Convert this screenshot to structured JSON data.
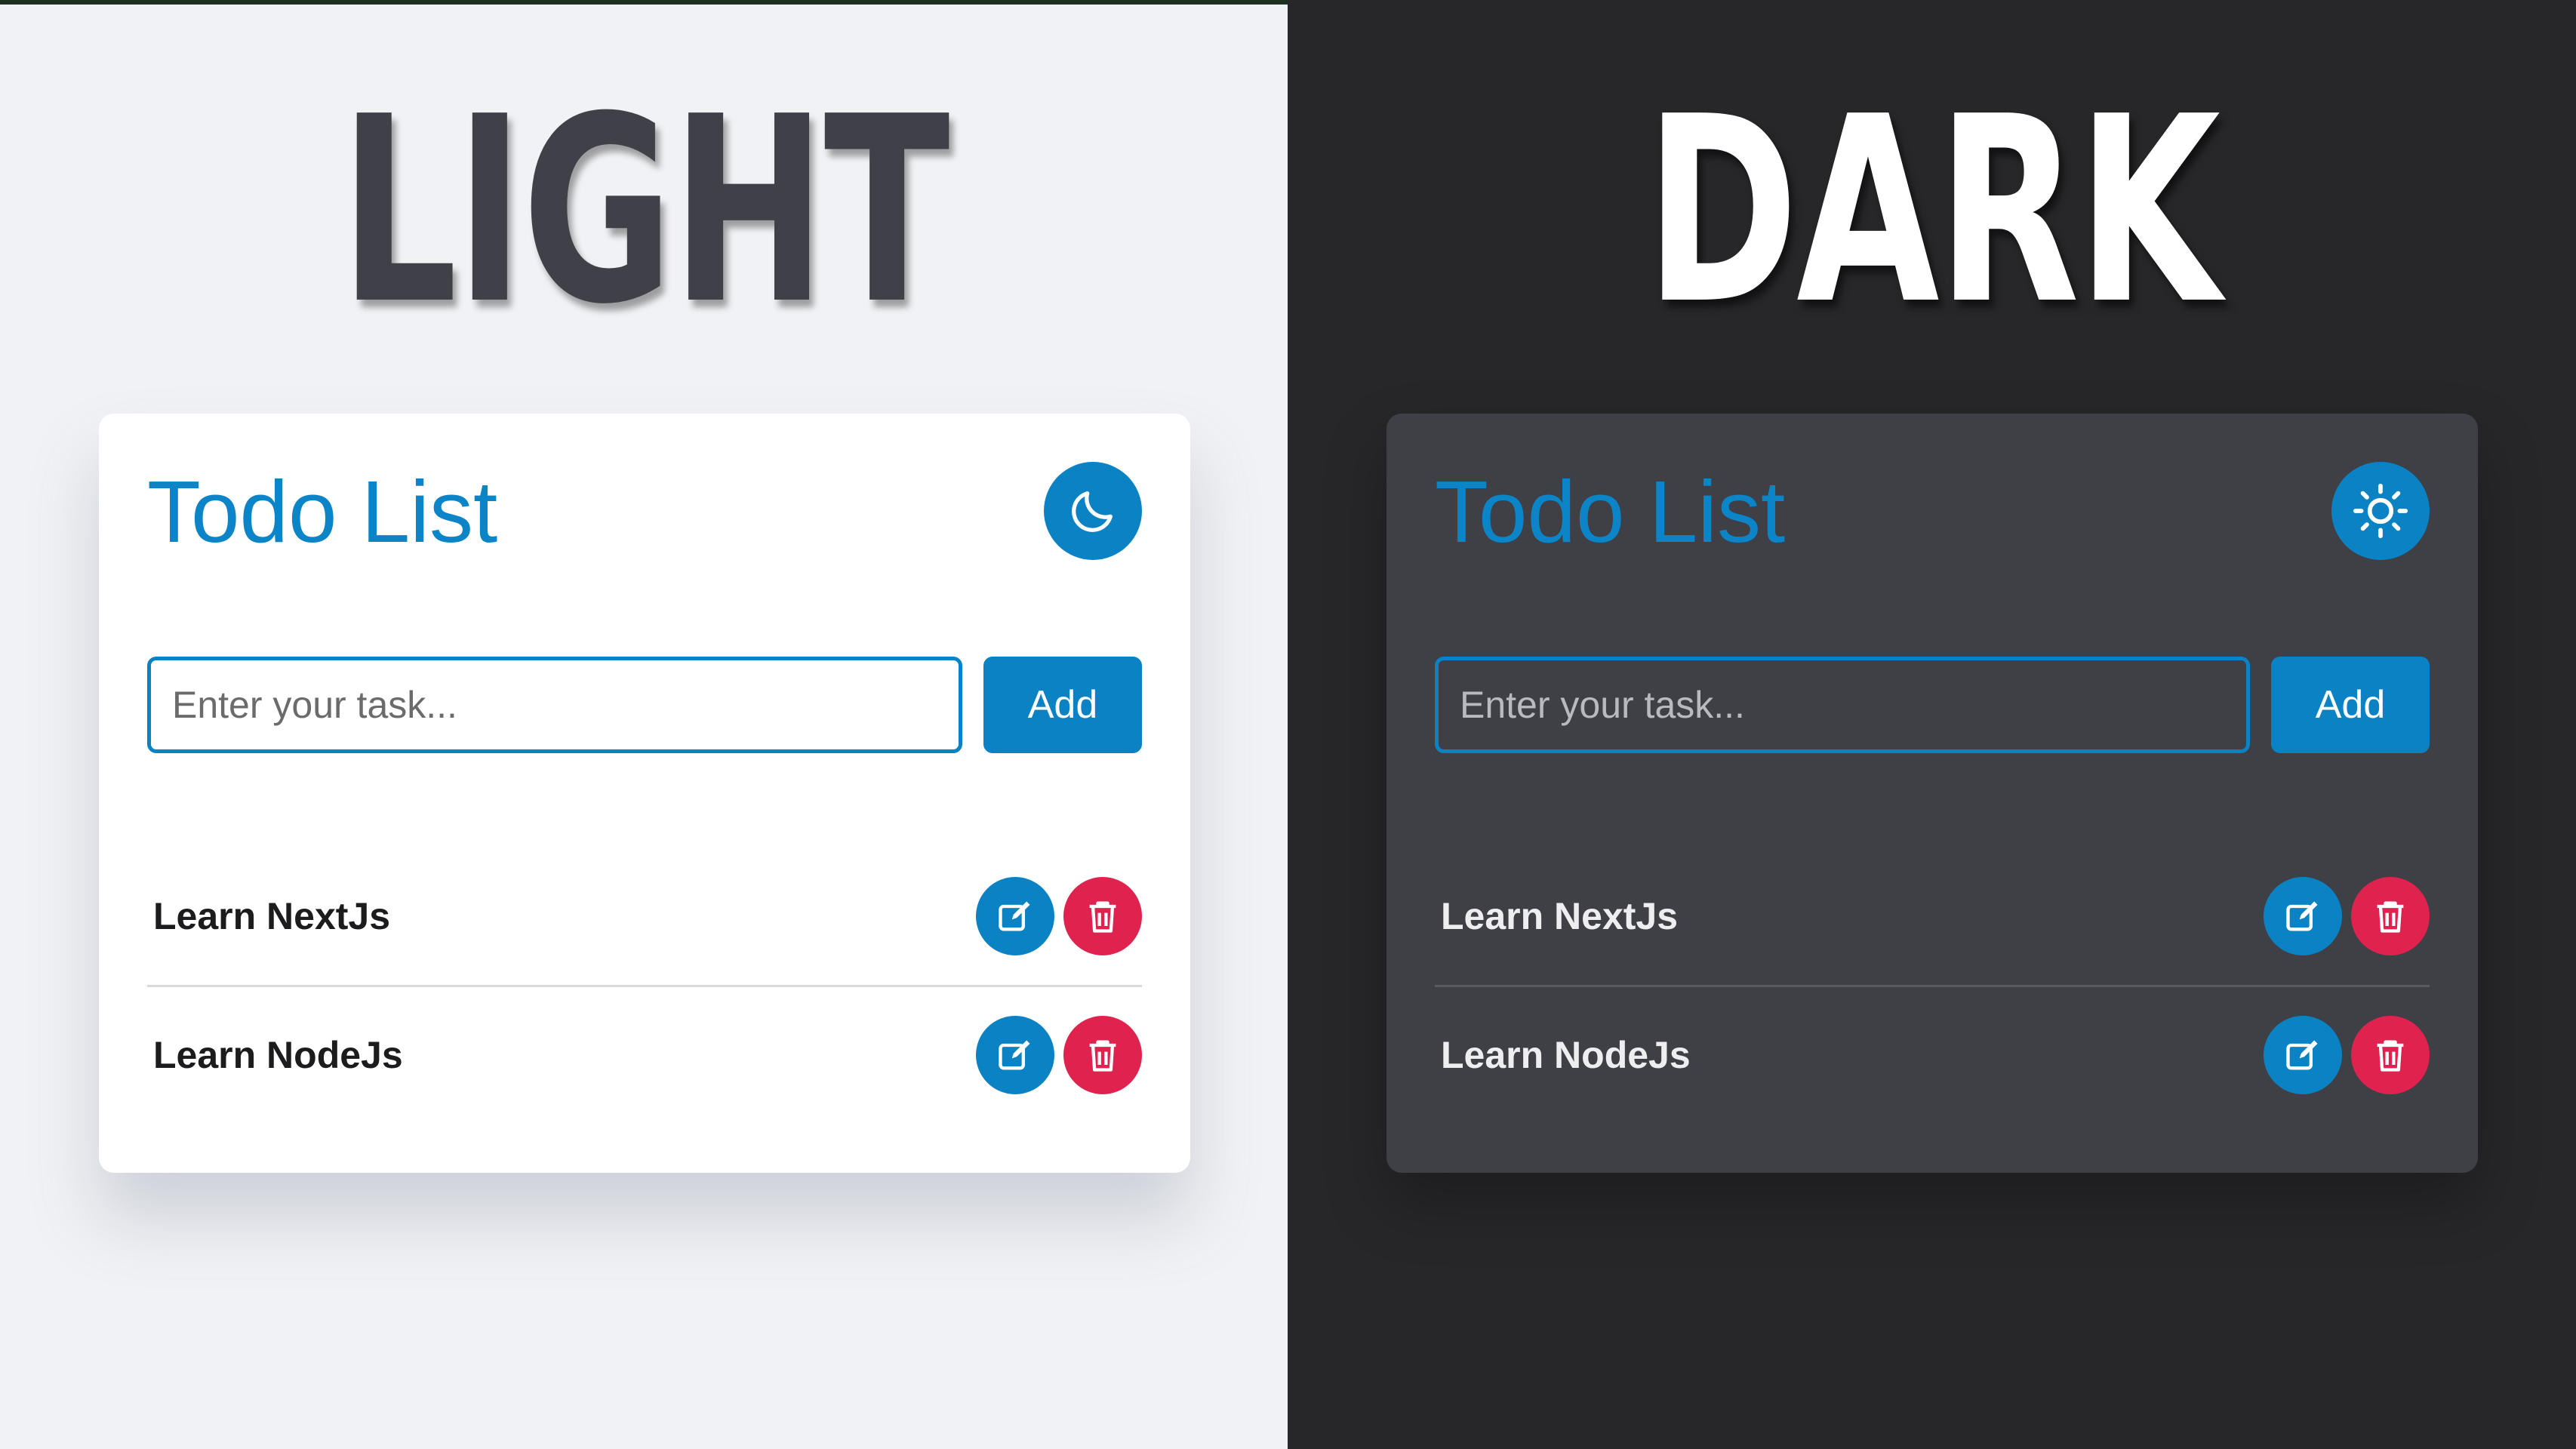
{
  "light": {
    "heading": "LIGHT",
    "title": "Todo List",
    "theme_icon": "moon-icon",
    "input_placeholder": "Enter your task...",
    "add_label": "Add",
    "todos": [
      {
        "text": "Learn NextJs"
      },
      {
        "text": "Learn NodeJs"
      }
    ]
  },
  "dark": {
    "heading": "DARK",
    "title": "Todo List",
    "theme_icon": "sun-icon",
    "input_placeholder": "Enter your task...",
    "add_label": "Add",
    "todos": [
      {
        "text": "Learn NextJs"
      },
      {
        "text": "Learn NodeJs"
      }
    ]
  },
  "colors": {
    "accent": "#0a82c4",
    "danger": "#e0224f",
    "light_bg": "#f1f2f5",
    "dark_bg": "#27272a",
    "dark_card": "#3f3f46"
  }
}
